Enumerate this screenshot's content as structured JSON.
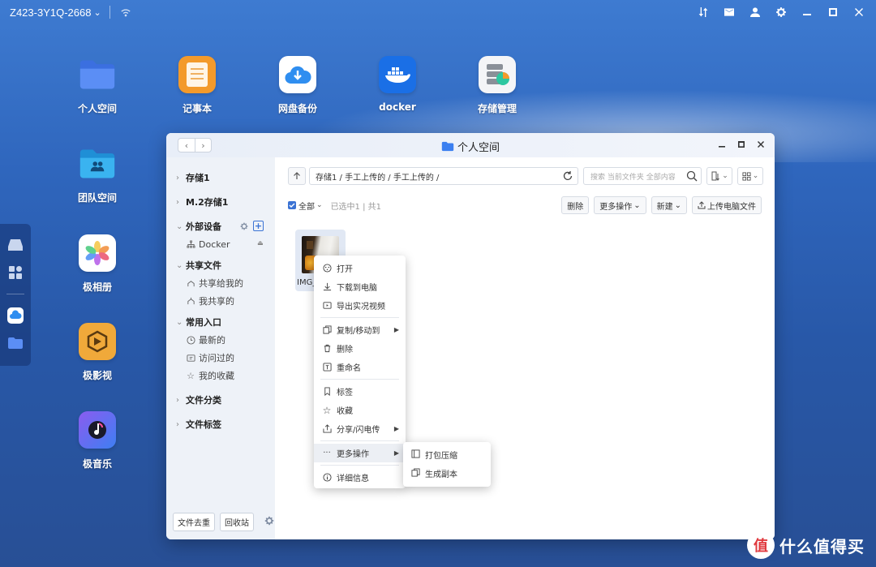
{
  "topbar": {
    "device_name": "Z423-3Y1Q-2668",
    "dropdown_glyph": "⌄",
    "icons": [
      "wifi-icon",
      "transfer-icon",
      "mail-icon",
      "user-icon",
      "settings-icon",
      "minimize-icon",
      "maximize-icon",
      "close-icon"
    ]
  },
  "desktop": {
    "apps": [
      {
        "label": "个人空间",
        "icon": "folder-icon"
      },
      {
        "label": "记事本",
        "icon": "notepad-icon"
      },
      {
        "label": "网盘备份",
        "icon": "cloud-backup-icon"
      },
      {
        "label": "docker",
        "icon": "docker-icon"
      },
      {
        "label": "存储管理",
        "icon": "storage-icon"
      },
      {
        "label": "团队空间",
        "icon": "team-folder-icon"
      },
      {
        "label": "极相册",
        "icon": "photos-icon"
      },
      {
        "label": "极影视",
        "icon": "video-icon"
      },
      {
        "label": "极音乐",
        "icon": "music-icon"
      }
    ]
  },
  "dock": {
    "icons": [
      "drive-icon",
      "apps-grid-icon",
      "cloud-icon",
      "folder-icon"
    ]
  },
  "window": {
    "title": "个人空间",
    "nav_back": "‹",
    "nav_forward": "›"
  },
  "sidebar": {
    "groups": [
      {
        "label": "存储1",
        "expanded": false,
        "items": []
      },
      {
        "label": "M.2存储1",
        "expanded": false,
        "items": []
      },
      {
        "label": "外部设备",
        "expanded": true,
        "items": [
          {
            "label": "Docker",
            "icon": "tree-icon"
          }
        ]
      },
      {
        "label": "共享文件",
        "expanded": true,
        "items": [
          {
            "label": "共享给我的",
            "icon": "share-in-icon"
          },
          {
            "label": "我共享的",
            "icon": "share-out-icon"
          }
        ]
      },
      {
        "label": "常用入口",
        "expanded": true,
        "items": [
          {
            "label": "最新的",
            "icon": "clock-icon"
          },
          {
            "label": "访问过的",
            "icon": "history-icon"
          },
          {
            "label": "我的收藏",
            "icon": "star-icon"
          }
        ]
      },
      {
        "label": "文件分类",
        "expanded": false,
        "items": []
      },
      {
        "label": "文件标签",
        "expanded": false,
        "items": []
      }
    ],
    "bottom": {
      "dedupe": "文件去重",
      "recycle": "回收站"
    }
  },
  "toolbar": {
    "path": "存储1 / 手工上传的 / 手工上传的 /",
    "search_placeholder": "搜索 当前文件夹 全部内容"
  },
  "actions": {
    "select_all": "全部",
    "selection_info": "已选中1 | 共1",
    "delete": "删除",
    "more_ops": "更多操作",
    "new": "新建",
    "upload": "上传电脑文件"
  },
  "files": [
    {
      "name": "IMG_"
    }
  ],
  "context_menu": {
    "items": [
      {
        "label": "打开",
        "icon": "open-icon"
      },
      {
        "label": "下载到电脑",
        "icon": "download-icon"
      },
      {
        "label": "导出实况视频",
        "icon": "export-video-icon"
      },
      {
        "label": "复制/移动到",
        "icon": "copy-icon",
        "submenu": true
      },
      {
        "label": "删除",
        "icon": "trash-icon"
      },
      {
        "label": "重命名",
        "icon": "rename-icon"
      },
      {
        "label": "标签",
        "icon": "tag-icon"
      },
      {
        "label": "收藏",
        "icon": "star-icon"
      },
      {
        "label": "分享/闪电传",
        "icon": "share-icon",
        "submenu": true
      },
      {
        "label": "更多操作",
        "icon": "more-icon",
        "submenu": true
      },
      {
        "label": "详细信息",
        "icon": "info-icon"
      }
    ]
  },
  "submenu": {
    "items": [
      {
        "label": "打包压缩",
        "icon": "archive-icon"
      },
      {
        "label": "生成副本",
        "icon": "duplicate-icon"
      }
    ]
  },
  "watermark": {
    "logo_char": "值",
    "text": "什么值得买"
  },
  "colors": {
    "accent": "#3b73d4",
    "desktop": "#2f66bd"
  }
}
